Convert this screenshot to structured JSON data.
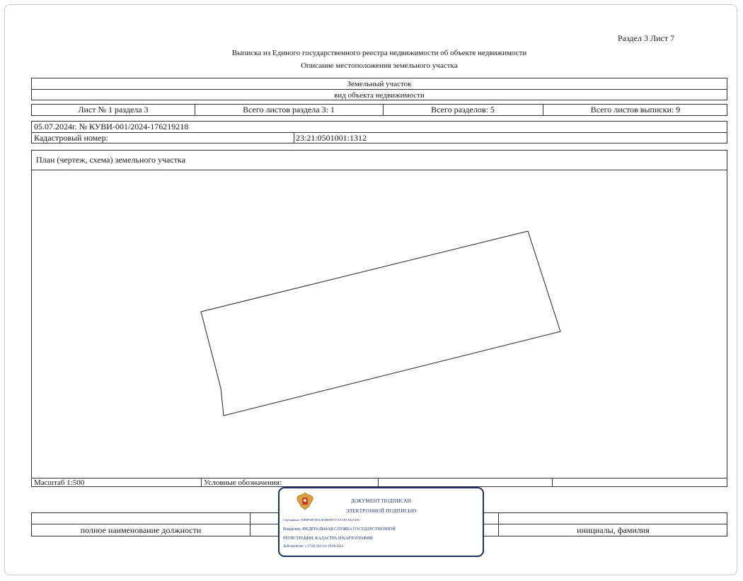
{
  "header": {
    "section_sheet": "Раздел 3   Лист 7",
    "title": "Выписка из Единого государственного реестра недвижимости об объекте недвижимости",
    "subtitle": "Описание местоположения земельного участка"
  },
  "object_table": {
    "object_type": "Земельный участок",
    "object_kind_caption": "вид объекта недвижимости",
    "sheet_cells": [
      "Лист № 1 раздела 3",
      "Всего листов раздела 3: 1",
      "Всего разделов: 5",
      "Всего листов выписки: 9"
    ]
  },
  "record": {
    "date_number": "05.07.2024г. № КУВИ-001/2024-176219218",
    "cadastral_label": "Кадастровый номер:",
    "cadastral_value": "23:21:0501001:1312"
  },
  "plan": {
    "title": "План (чертеж, схема) земельного участка",
    "scale": "Масштаб 1:500",
    "legend_label": "Условные обозначения:"
  },
  "signature_table": {
    "position_caption": "полное наименование должности",
    "name_caption": "инициалы, фамилия"
  },
  "stamp": {
    "line1": "ДОКУМЕНТ ПОДПИСАН",
    "line2": "ЭЛЕКТРОННОЙ ПОДПИСЬЮ",
    "certificate": "Сертификат: 00B8F6B7483CB3BDEE57AACDC8425100",
    "owner_line1": "Владелец: ФЕДЕРАЛЬНАЯ СЛУЖБА ГОСУДАРСТВЕННОЙ",
    "owner_line2": "РЕГИСТРАЦИИ, КАДАСТРА И КАРТОГРАФИИ",
    "valid": "Действителен: с 27.06.2023 по 19.09.2024",
    "emblem_icon": "coat-of-arms-icon",
    "color": "#1e2f6b"
  }
}
